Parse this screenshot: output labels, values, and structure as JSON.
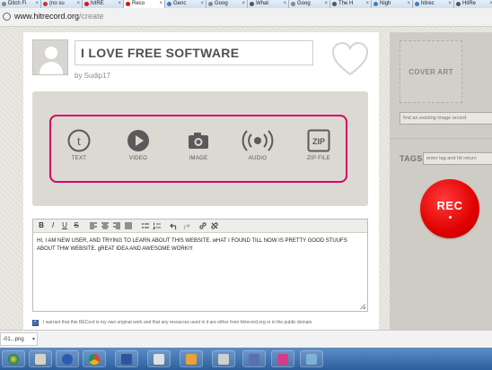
{
  "browser": {
    "tabs": [
      {
        "label": "Ditch Fi",
        "fav": "#888888",
        "active": false
      },
      {
        "label": "(no su",
        "fav": "#cc3333",
        "active": false
      },
      {
        "label": "hitRE",
        "fav": "#e01010",
        "active": false
      },
      {
        "label": "Reco",
        "fav": "#e01010",
        "active": true
      },
      {
        "label": "Genc",
        "fav": "#4a7ab8",
        "active": false
      },
      {
        "label": "Goog",
        "fav": "#888888",
        "active": false
      },
      {
        "label": "What",
        "fav": "#555555",
        "active": false
      },
      {
        "label": "Goog",
        "fav": "#888888",
        "active": false
      },
      {
        "label": "The H",
        "fav": "#555555",
        "active": false
      },
      {
        "label": "Nigh",
        "fav": "#4a7ab8",
        "active": false
      },
      {
        "label": "hitrec",
        "fav": "#4a7ab8",
        "active": false
      },
      {
        "label": "HitRe",
        "fav": "#555555",
        "active": false
      }
    ],
    "url_domain": "www.hitrecord.org",
    "url_path": "/create"
  },
  "record": {
    "title": "I LOVE FREE SOFTWARE",
    "byline": "by Sudip17"
  },
  "media_options": [
    {
      "label": "TEXT",
      "icon": "text-icon"
    },
    {
      "label": "VIDEO",
      "icon": "video-play-icon"
    },
    {
      "label": "IMAGE",
      "icon": "camera-icon"
    },
    {
      "label": "AUDIO",
      "icon": "audio-icon"
    },
    {
      "label": "ZIP FILE",
      "icon": "zip-file-icon",
      "glyph": "ZIP"
    }
  ],
  "editor": {
    "toolbar": [
      "B",
      "I",
      "U",
      "S"
    ],
    "body": "HI, I AM NEW USER, AND TRYING TO LEARN ABOUT THIS WEBSITE. wHAT I FOUND TILL NOW IS PRETTY GOOD STUUFS ABOUT THW WEBSITE. gREAT IDEA AND AWESOME WORK!!!"
  },
  "warrant": {
    "text": "I warrant that this RECord is my own original work and that any resources used in it are either from hitrecord.org or in the public domain.",
    "checked": true
  },
  "sidebar": {
    "cover_art": "COVER ART",
    "find_image_placeholder": "find an existing image record",
    "tags_label": "TAGS",
    "tags_placeholder": "enter tag and hit return",
    "rec_label": "REC"
  },
  "download": {
    "file": "-01...png"
  },
  "colors": {
    "accent": "#d7006b",
    "rec": "#e00000"
  }
}
